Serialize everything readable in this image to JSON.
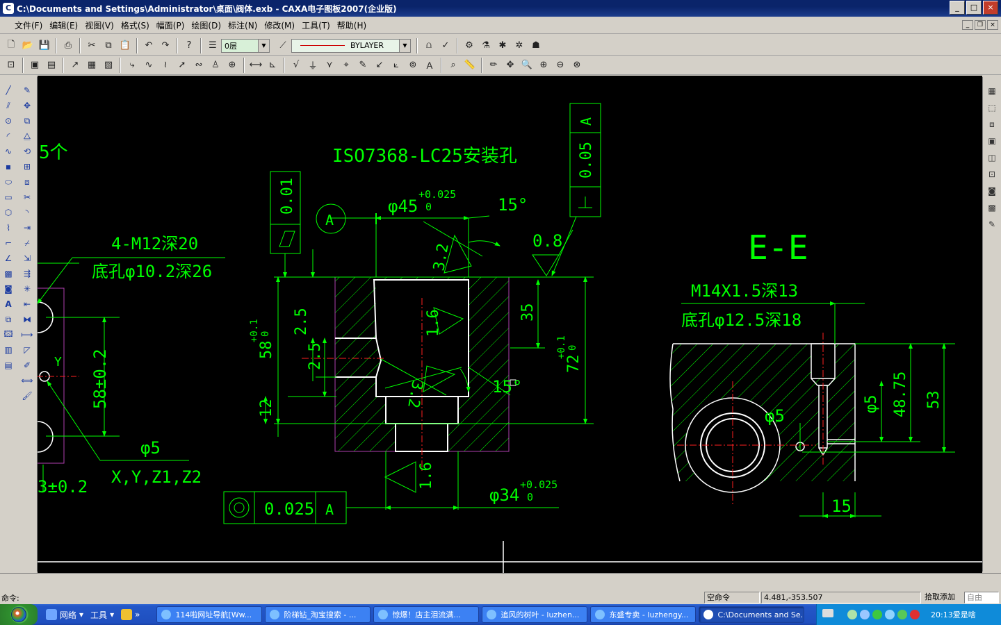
{
  "window": {
    "title": "C:\\Documents and Settings\\Administrator\\桌面\\阀体.exb - CAXA电子图板2007(企业版)",
    "icon": "caxa-app-icon",
    "buttons": [
      "_",
      "□",
      "×"
    ]
  },
  "menu": [
    "文件(F)",
    "编辑(E)",
    "视图(V)",
    "格式(S)",
    "幅面(P)",
    "绘图(D)",
    "标注(N)",
    "修改(M)",
    "工具(T)",
    "帮助(H)"
  ],
  "toolbar": {
    "layer": "0层",
    "linetype": "BYLAYER"
  },
  "drawing": {
    "texts": {
      "count5": "5个",
      "iso_title": "ISO7368-LC25安装孔",
      "datum_a": "A",
      "dim_45": "φ45",
      "tol_45_up": "+0.025",
      "tol_45_low": "0",
      "angle_top": "15°",
      "ra_08": "0.8",
      "flat_001": "0.01",
      "perp_005": "0.05",
      "perp_a": "A",
      "chamfer_32a": "3.2",
      "chamfer_32b": "3.2",
      "thread_m12": "4-M12深20",
      "bore_102": "底孔φ10.2深26",
      "dim_25a": "2.5",
      "dim_25b": "2.5",
      "dim_58": "58",
      "tol_58_up": "+0.1",
      "tol_58_low": "0",
      "ra_16a": "1.6",
      "dim_35": "35",
      "dim_72": "72",
      "tol_72_up": "+0.1",
      "tol_72_low": "0",
      "angle_mid": "15°",
      "dim_12": "12",
      "dim_58pm": "58±0.2",
      "axis_y": "Y",
      "dia_5": "φ5",
      "xyzz": "X,Y,Z1,Z2",
      "dim_3pm": "3±0.2",
      "ra_16b": "1.6",
      "dim_34": "φ34",
      "tol_34_up": "+0.025",
      "tol_34_low": "0",
      "conc_val": "0.025",
      "conc_ref": "A",
      "section_ee": "E-E",
      "thread_m14": "M14X1.5深13",
      "bore_125": "底孔φ12.5深18",
      "dia_5b": "φ5",
      "dia_5c": "φ5",
      "dim_4875": "48.75",
      "dim_53": "53",
      "dim_15": "15"
    }
  },
  "status": {
    "command_label": "命令:",
    "empty_command": "空命令",
    "coords": "4.481,-353.507",
    "pick_mode": "拾取添加",
    "snap_mode": "自由"
  },
  "taskbar": {
    "quick": [
      "网络",
      "工具"
    ],
    "tasks": [
      "114啦网址导航[Ww...",
      "阶梯钻_淘宝搜索 - ...",
      "惊爆！店主泪流满...",
      "追风的树叶 - luzhen...",
      "东盛专卖 - luzhengy...",
      "C:\\Documents and Se..."
    ],
    "clock": "20:13爱是啥"
  },
  "colors": {
    "canvas_bg": "#000000",
    "line_green": "#00ff00",
    "hatch": "#b040b0",
    "center_red": "#ff2020",
    "outline_white": "#ffffff"
  }
}
